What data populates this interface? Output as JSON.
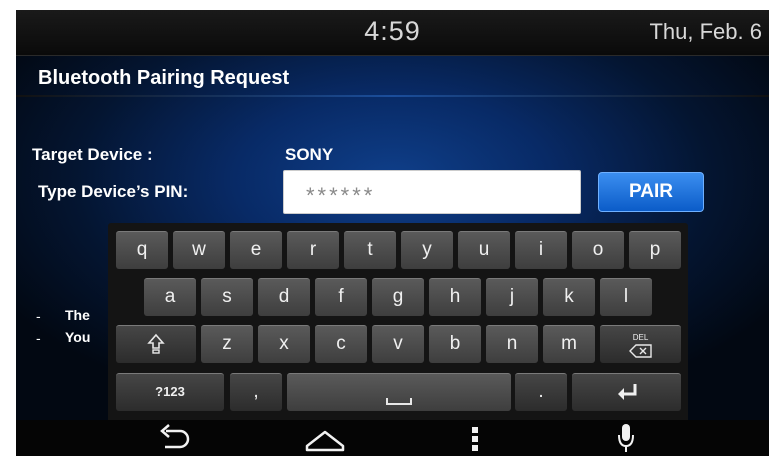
{
  "status_bar": {
    "time": "4:59",
    "date": "Thu, Feb. 6"
  },
  "dialog": {
    "title": "Bluetooth Pairing Request",
    "target_device_label": "Target Device :",
    "target_device_value": "SONY",
    "pin_label": "Type Device’s PIN:",
    "pin_value": "******",
    "pair_button": "PAIR",
    "notes": [
      {
        "dash": "-",
        "text": "The"
      },
      {
        "dash": "-",
        "text": "You"
      }
    ]
  },
  "keyboard": {
    "row1": [
      "q",
      "w",
      "e",
      "r",
      "t",
      "y",
      "u",
      "i",
      "o",
      "p"
    ],
    "row2": [
      "a",
      "s",
      "d",
      "f",
      "g",
      "h",
      "j",
      "k",
      "l"
    ],
    "row3": [
      "z",
      "x",
      "c",
      "v",
      "b",
      "n",
      "m"
    ],
    "shift_icon": "shift-icon",
    "delete_label": "DEL",
    "symbols_key": "?123",
    "comma_key": ",",
    "period_key": ".",
    "enter_icon": "enter-icon",
    "space_icon": "space-icon"
  },
  "nav_bar": {
    "icons": [
      "back-icon",
      "home-icon",
      "menu-icon",
      "microphone-icon"
    ]
  }
}
